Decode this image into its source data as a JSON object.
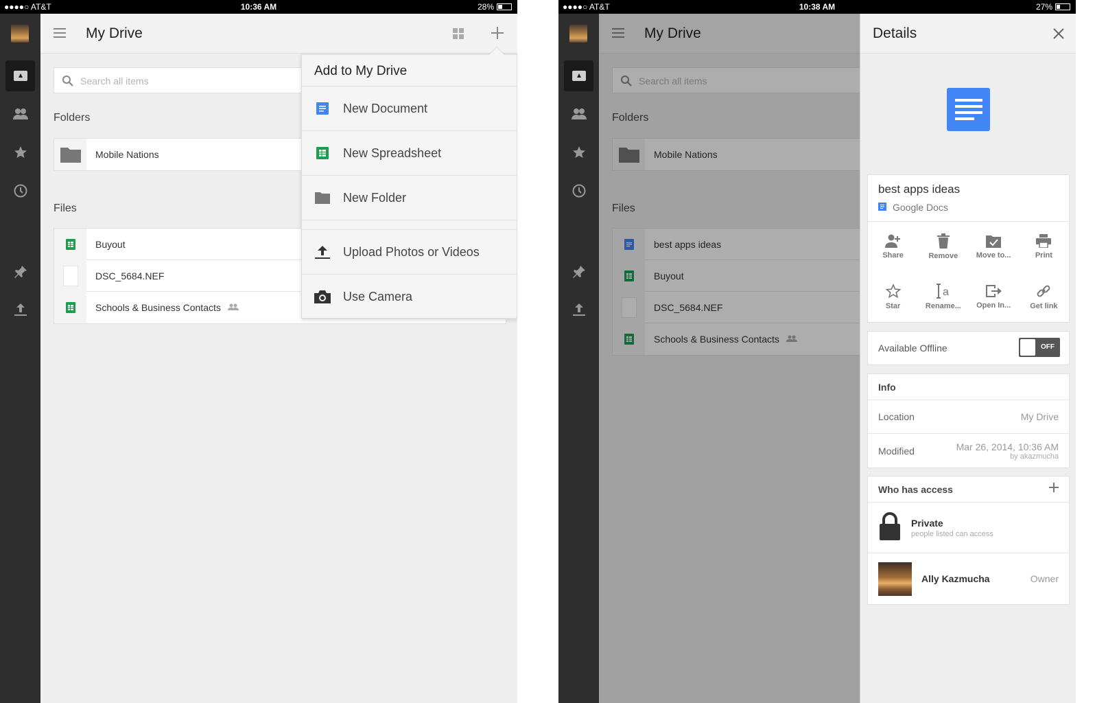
{
  "left_screen": {
    "status": {
      "carrier": "●●●●○ AT&T",
      "time": "10:36 AM",
      "battery": "28%",
      "battery_level": 0.28
    },
    "appbar": {
      "title": "My Drive"
    },
    "search": {
      "placeholder": "Search all items"
    },
    "folders": {
      "heading": "Folders",
      "items": [
        {
          "name": "Mobile Nations"
        }
      ]
    },
    "files": {
      "heading": "Files",
      "items": [
        {
          "name": "Buyout",
          "type": "spreadsheet",
          "shared": false
        },
        {
          "name": "DSC_5684.NEF",
          "type": "image",
          "shared": false
        },
        {
          "name": "Schools & Business Contacts",
          "type": "spreadsheet",
          "shared": true
        }
      ]
    },
    "dropdown": {
      "title": "Add to My Drive",
      "items": [
        {
          "label": "New Document",
          "icon": "document-icon"
        },
        {
          "label": "New Spreadsheet",
          "icon": "spreadsheet-icon"
        },
        {
          "label": "New Folder",
          "icon": "folder-icon"
        },
        {
          "label": "Upload Photos or Videos",
          "icon": "upload-icon"
        },
        {
          "label": "Use Camera",
          "icon": "camera-icon"
        }
      ]
    }
  },
  "right_screen": {
    "status": {
      "carrier": "●●●●○ AT&T",
      "time": "10:38 AM",
      "battery": "27%",
      "battery_level": 0.27
    },
    "appbar": {
      "title": "My Drive"
    },
    "search": {
      "placeholder": "Search all items"
    },
    "folders": {
      "heading": "Folders",
      "items": [
        {
          "name": "Mobile Nations"
        }
      ]
    },
    "files": {
      "heading": "Files",
      "items": [
        {
          "name": "best apps ideas",
          "type": "document",
          "shared": false
        },
        {
          "name": "Buyout",
          "type": "spreadsheet",
          "shared": false
        },
        {
          "name": "DSC_5684.NEF",
          "type": "image",
          "shared": false
        },
        {
          "name": "Schools & Business Contacts",
          "type": "spreadsheet",
          "shared": true
        }
      ]
    },
    "details": {
      "title": "Details",
      "file_name": "best apps ideas",
      "file_type": "Google Docs",
      "actions": [
        {
          "label": "Share",
          "icon": "add-person-icon"
        },
        {
          "label": "Remove",
          "icon": "trash-icon"
        },
        {
          "label": "Move to...",
          "icon": "move-folder-icon"
        },
        {
          "label": "Print",
          "icon": "print-icon"
        },
        {
          "label": "Star",
          "icon": "star-icon"
        },
        {
          "label": "Rename...",
          "icon": "rename-icon"
        },
        {
          "label": "Open In...",
          "icon": "open-in-icon"
        },
        {
          "label": "Get link",
          "icon": "link-icon"
        }
      ],
      "offline": {
        "label": "Available Offline",
        "state": "OFF"
      },
      "info": {
        "heading": "Info",
        "location_label": "Location",
        "location_value": "My Drive",
        "modified_label": "Modified",
        "modified_value": "Mar 26, 2014, 10:36 AM",
        "modified_by": "by akazmucha"
      },
      "access": {
        "heading": "Who has access",
        "private_title": "Private",
        "private_sub": "people listed can access",
        "owner_name": "Ally Kazmucha",
        "owner_role": "Owner"
      }
    }
  },
  "colors": {
    "doc": "#4285f4",
    "sheet": "#1d9e4f",
    "rail": "#2e2e2e"
  }
}
